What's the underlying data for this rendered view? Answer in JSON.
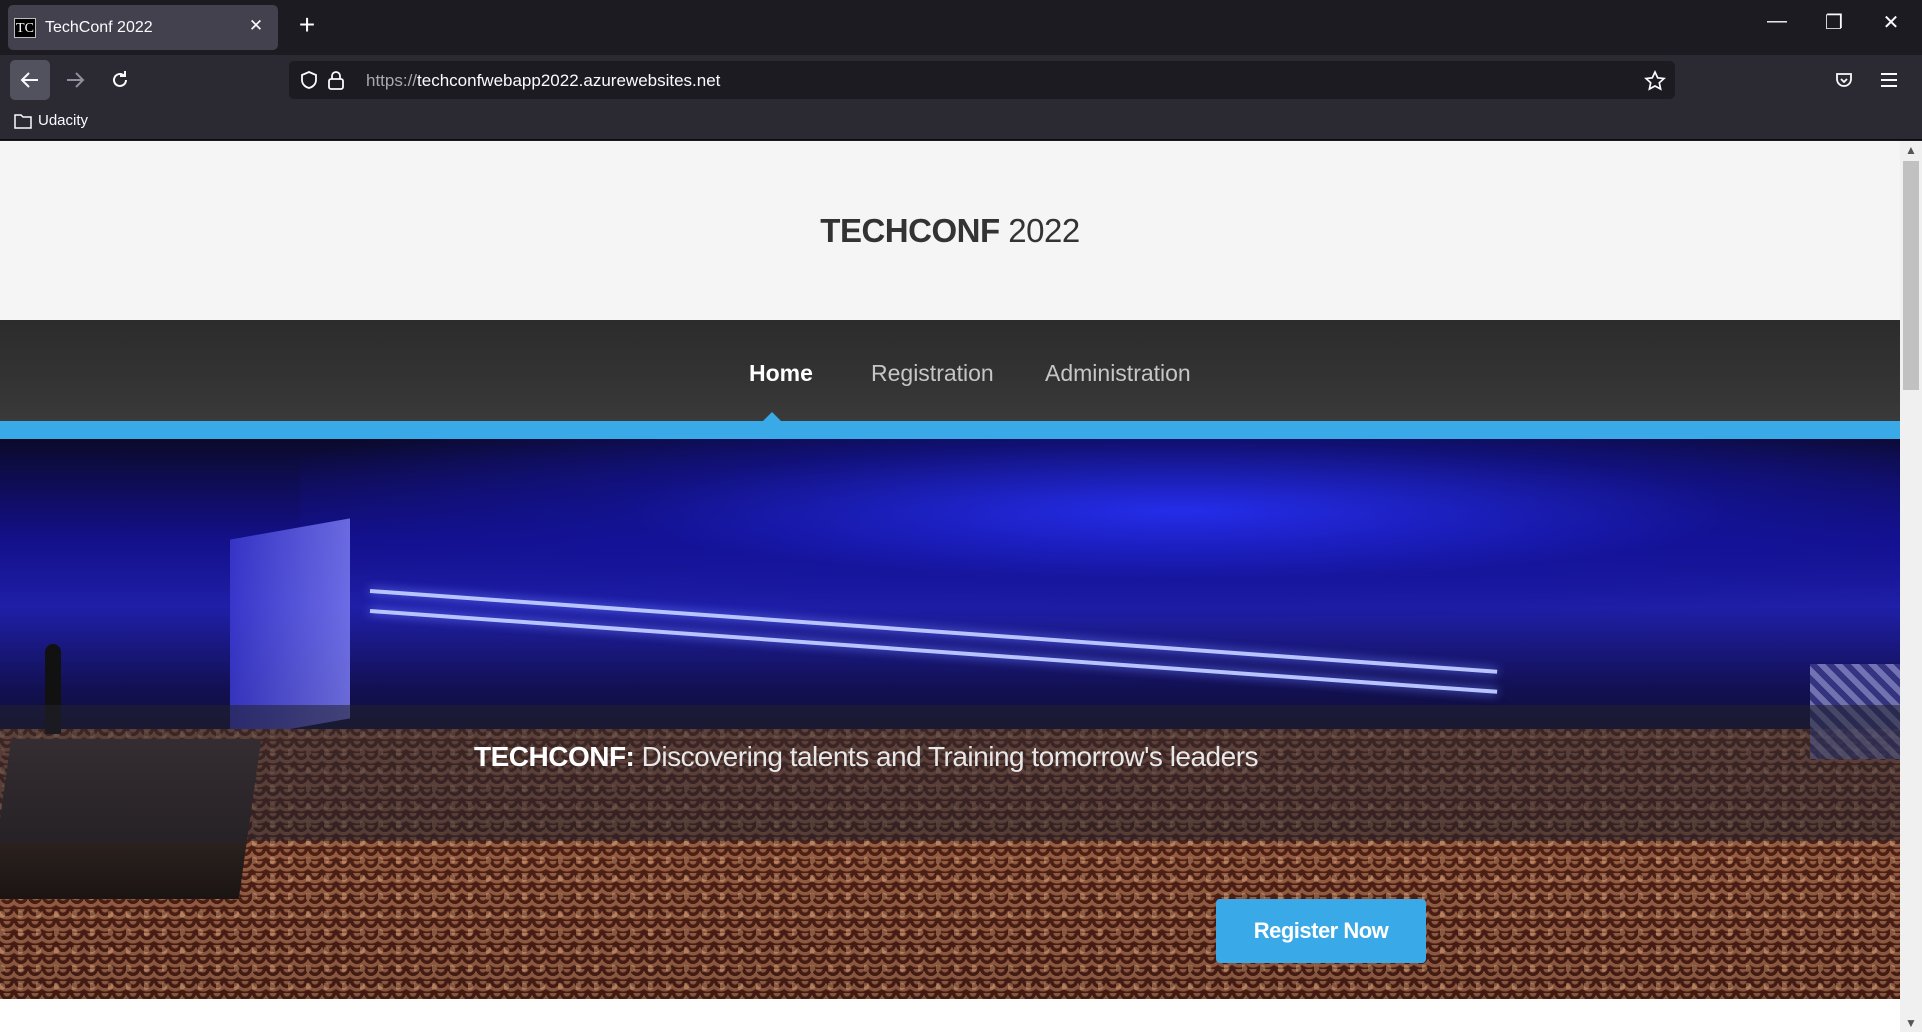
{
  "browser": {
    "tab": {
      "favicon_text": "TC",
      "title": "TechConf 2022",
      "close": "✕"
    },
    "new_tab": "+",
    "window_controls": {
      "minimize": "—",
      "restore": "❐",
      "close": "✕"
    },
    "url": {
      "scheme": "https://",
      "host": "techconfwebapp2022.azurewebsites.net"
    },
    "bookmarks": [
      {
        "label": "Udacity",
        "icon": "folder-icon"
      }
    ]
  },
  "site": {
    "title_bold": "TECHCONF",
    "title_rest": " 2022",
    "nav": [
      {
        "label": "Home",
        "current": true
      },
      {
        "label": "Registration",
        "current": false
      },
      {
        "label": "Administration",
        "current": false
      }
    ],
    "accent_color": "#3aa9e8",
    "hero": {
      "tagline_brand": "TECHCONF:",
      "tagline_text": " Discovering talents and Training tomorrow's leaders",
      "cta_label": "Register Now"
    }
  }
}
